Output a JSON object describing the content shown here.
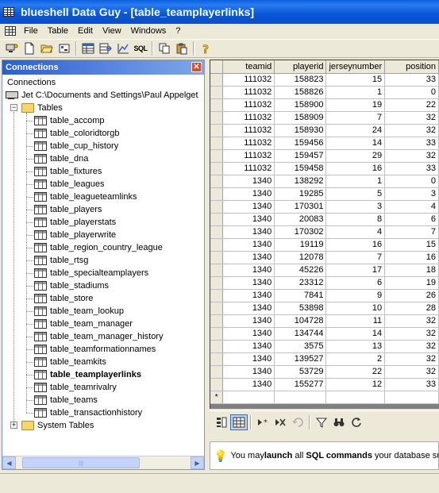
{
  "window": {
    "title": "blueshell Data Guy - [table_teamplayerlinks]"
  },
  "menu": {
    "items": [
      "File",
      "Table",
      "Edit",
      "View",
      "Windows",
      "?"
    ]
  },
  "toolbar": {
    "sql_label": "SQL"
  },
  "connections": {
    "header": "Connections",
    "root": "Connections",
    "db": "Jet  C:\\Documents and Settings\\Paul Appelget",
    "tables_folder": "Tables",
    "tables": [
      "table_accomp",
      "table_coloridtorgb",
      "table_cup_history",
      "table_dna",
      "table_fixtures",
      "table_leagues",
      "table_leagueteamlinks",
      "table_players",
      "table_playerstats",
      "table_playerwrite",
      "table_region_country_league",
      "table_rtsg",
      "table_specialteamplayers",
      "table_stadiums",
      "table_store",
      "table_team_lookup",
      "table_team_manager",
      "table_team_manager_history",
      "table_teamformationnames",
      "table_teamkits",
      "table_teamplayerlinks",
      "table_teamrivalry",
      "table_teams",
      "table_transactionhistory"
    ],
    "selected_table": "table_teamplayerlinks",
    "system_folder": "System Tables"
  },
  "grid": {
    "columns": [
      "teamid",
      "playerid",
      "jerseynumber",
      "position"
    ],
    "rows": [
      [
        "111032",
        "158823",
        "15",
        "33"
      ],
      [
        "111032",
        "158826",
        "1",
        "0"
      ],
      [
        "111032",
        "158900",
        "19",
        "22"
      ],
      [
        "111032",
        "158909",
        "7",
        "32"
      ],
      [
        "111032",
        "158930",
        "24",
        "32"
      ],
      [
        "111032",
        "159456",
        "14",
        "33"
      ],
      [
        "111032",
        "159457",
        "29",
        "32"
      ],
      [
        "111032",
        "159458",
        "16",
        "33"
      ],
      [
        "1340",
        "138292",
        "1",
        "0"
      ],
      [
        "1340",
        "19285",
        "5",
        "3"
      ],
      [
        "1340",
        "170301",
        "3",
        "4"
      ],
      [
        "1340",
        "20083",
        "8",
        "6"
      ],
      [
        "1340",
        "170302",
        "4",
        "7"
      ],
      [
        "1340",
        "19119",
        "16",
        "15"
      ],
      [
        "1340",
        "12078",
        "7",
        "16"
      ],
      [
        "1340",
        "45226",
        "17",
        "18"
      ],
      [
        "1340",
        "23312",
        "6",
        "19"
      ],
      [
        "1340",
        "7841",
        "9",
        "26"
      ],
      [
        "1340",
        "53898",
        "10",
        "28"
      ],
      [
        "1340",
        "104728",
        "11",
        "32"
      ],
      [
        "1340",
        "134744",
        "14",
        "32"
      ],
      [
        "1340",
        "3575",
        "13",
        "32"
      ],
      [
        "1340",
        "139527",
        "2",
        "32"
      ],
      [
        "1340",
        "53729",
        "22",
        "32"
      ],
      [
        "1340",
        "155277",
        "12",
        "33"
      ]
    ],
    "new_row_marker": "*"
  },
  "tip": {
    "prefix": "You may ",
    "bold1": "launch",
    "middle": " all ",
    "bold2": "SQL commands",
    "suffix": " your database su"
  },
  "colors": {
    "titlebar": "#0a5fde",
    "panel_header": "#2a5fd0",
    "chrome": "#ece9d8"
  }
}
